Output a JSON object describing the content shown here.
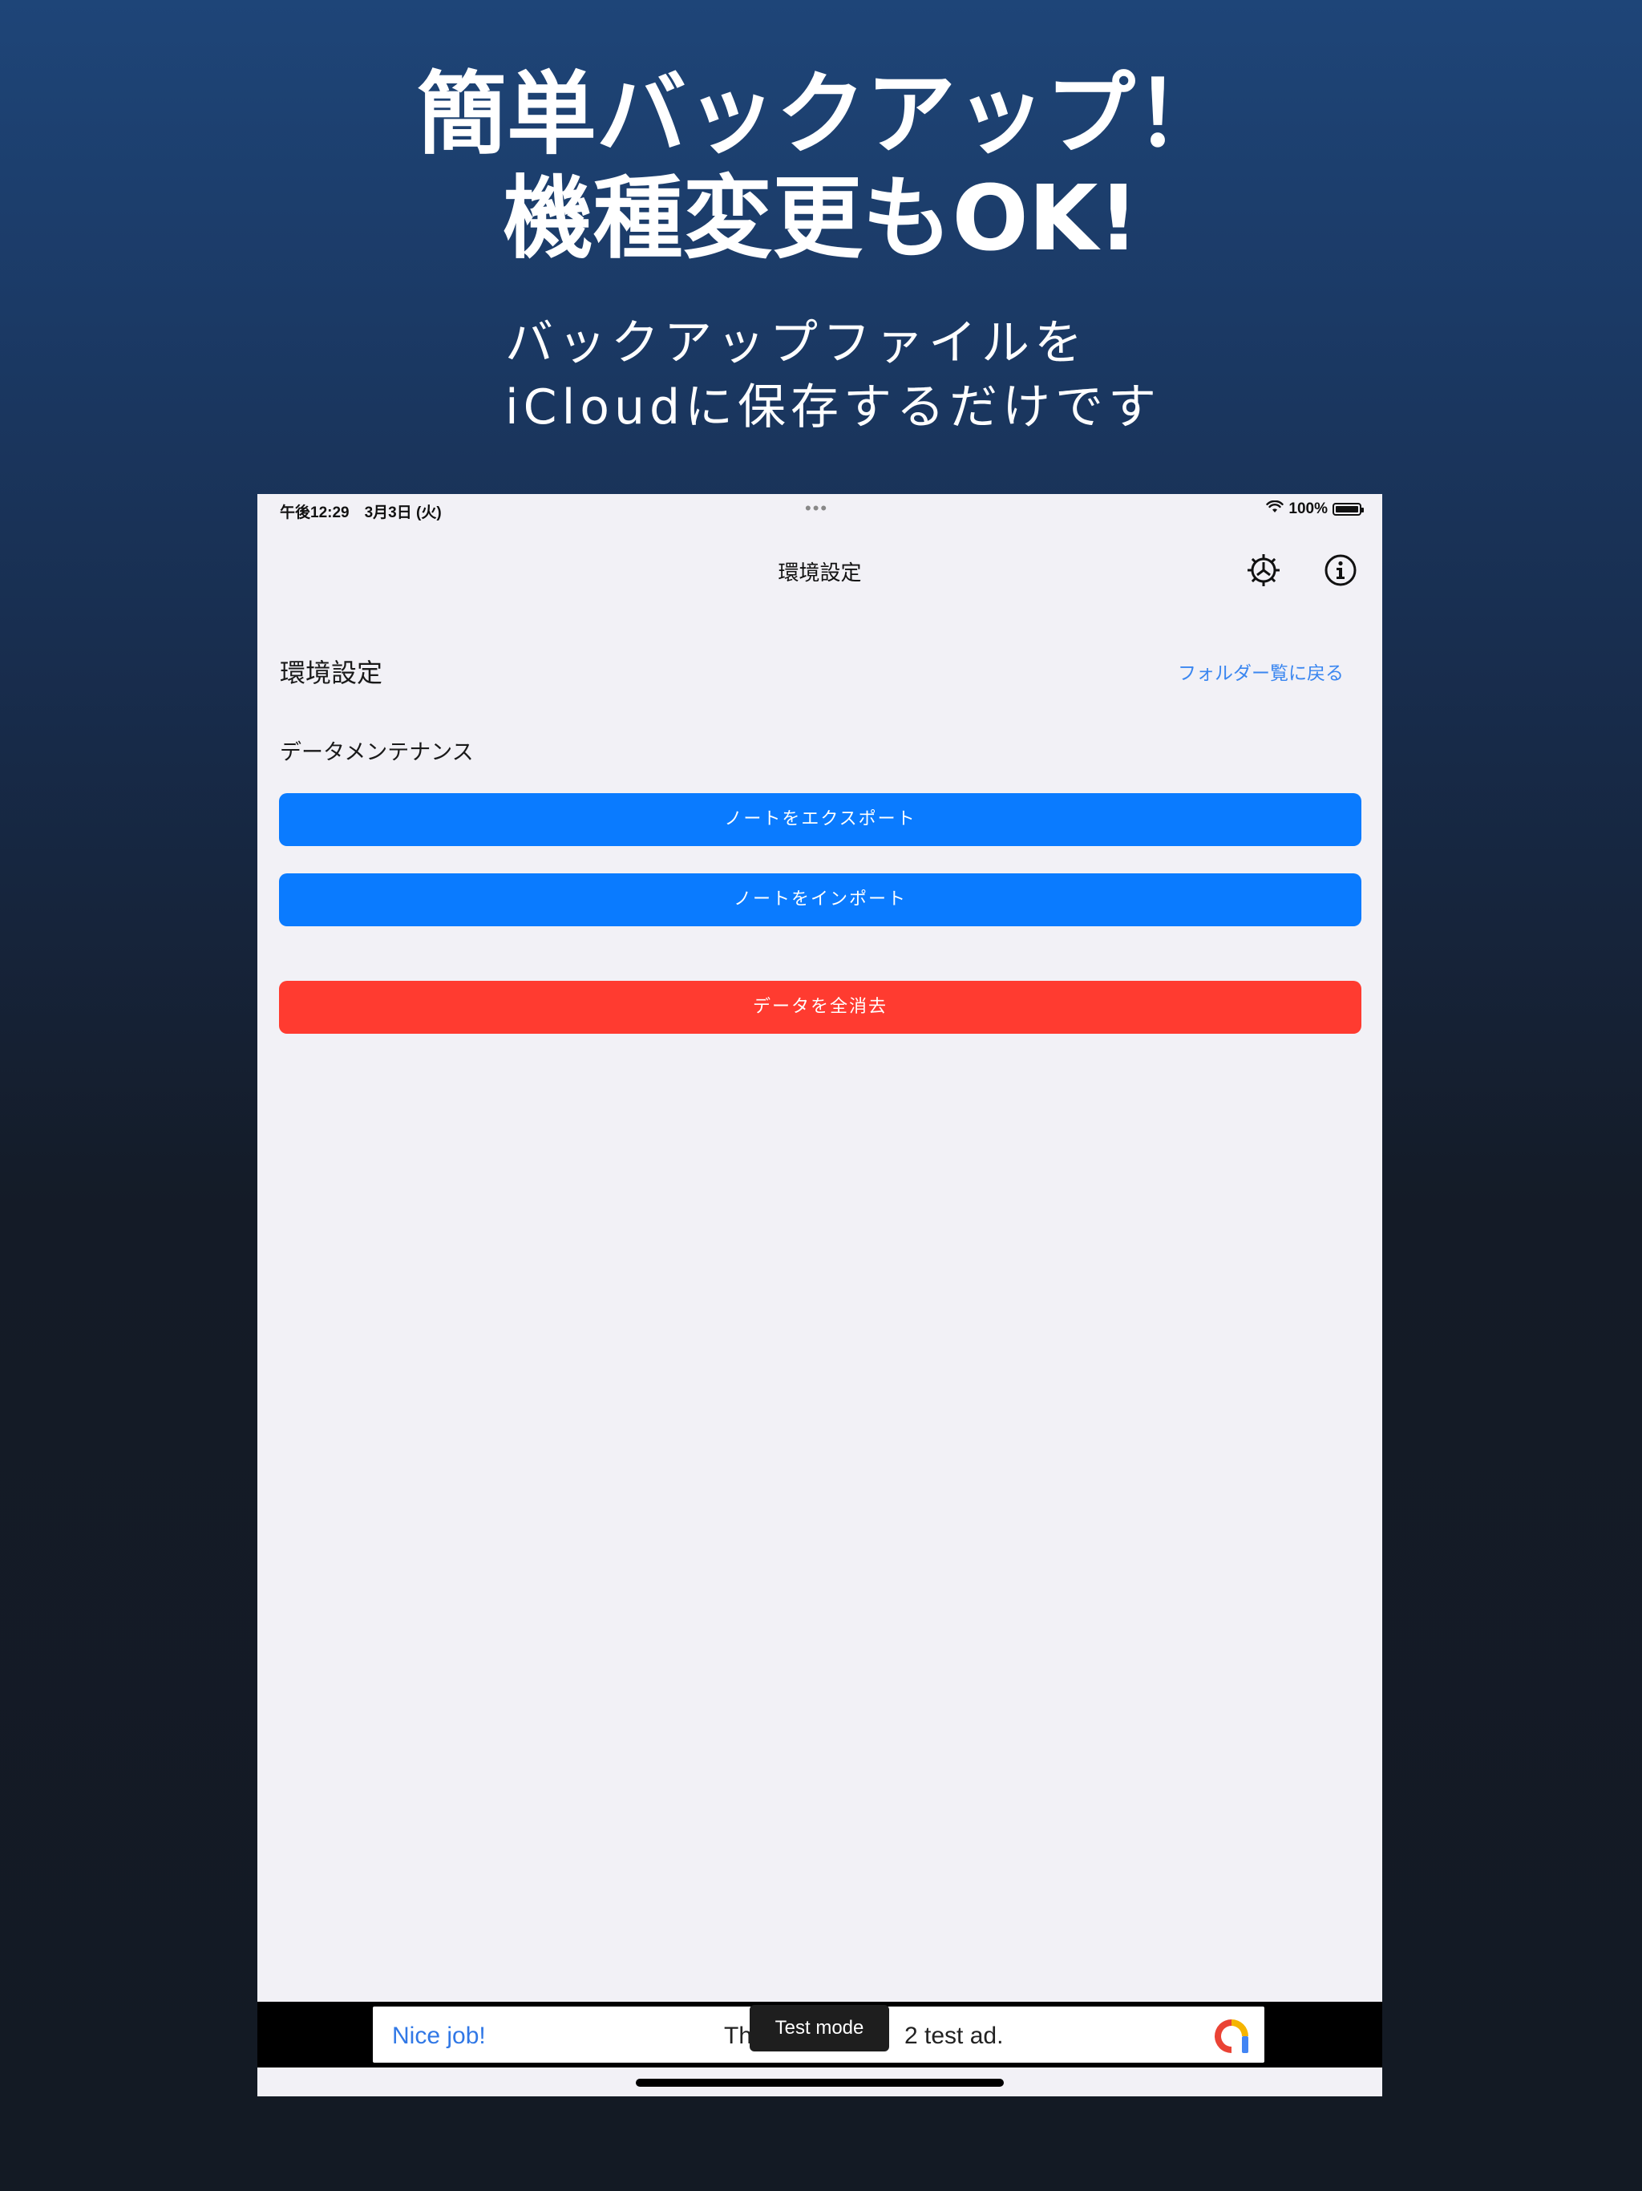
{
  "promo": {
    "headline": [
      "簡単バックアップ！",
      "機種変更もOK!"
    ],
    "subhead": [
      "バックアップファイルを",
      "iCloudに保存するだけです"
    ]
  },
  "status_bar": {
    "time_date": "午後12:29　3月3日 (火)",
    "multitask_dots": "•••",
    "battery": "100%"
  },
  "nav": {
    "title": "環境設定",
    "icons": [
      "gear-icon",
      "info-icon"
    ]
  },
  "settings": {
    "title": "環境設定",
    "back_link": "フォルダー覧に戻る",
    "section_label": "データメンテナンス",
    "export_label": "ノートをエクスポート",
    "import_label": "ノートをインポート",
    "delete_label": "データを全消去"
  },
  "ad": {
    "nice": "Nice job!",
    "text_left": "Th",
    "text_right": "2 test ad.",
    "badge": "Test mode"
  },
  "colors": {
    "primary_blue": "#0a7bff",
    "danger_red": "#ff3b30",
    "link_blue": "#3a86f0",
    "screen_bg": "#f2f1f6"
  }
}
